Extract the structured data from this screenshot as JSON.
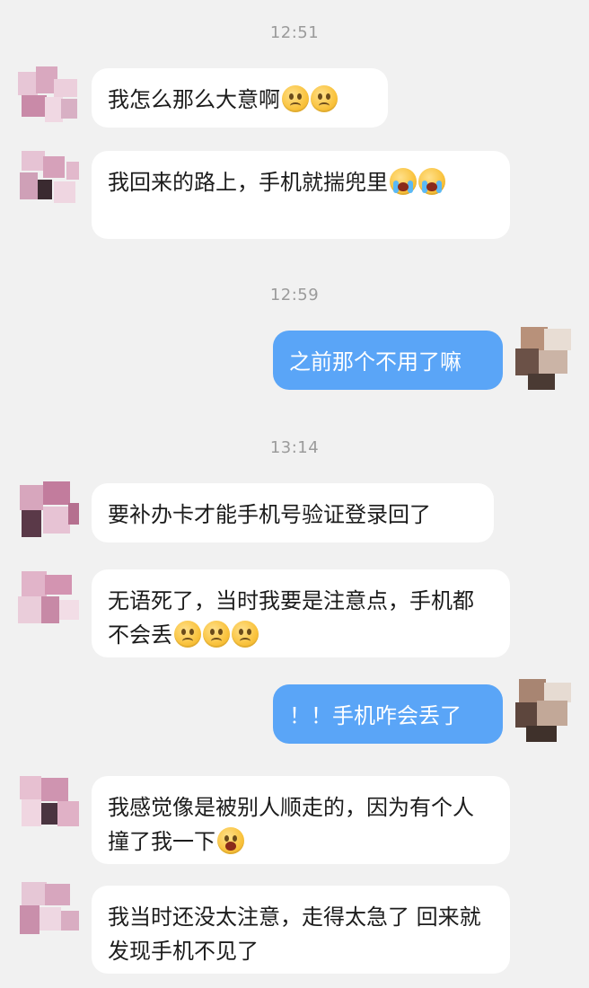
{
  "colors": {
    "background": "#f1f1f1",
    "incoming_bubble": "#ffffff",
    "outgoing_bubble": "#5aa5f7",
    "timestamp": "#9b9b9b"
  },
  "timestamps": [
    "12:51",
    "12:59",
    "13:14"
  ],
  "messages": [
    {
      "direction": "in",
      "text": "我怎么那么大意啊",
      "emojis": [
        "pleading-face-icon",
        "pleading-face-icon"
      ]
    },
    {
      "direction": "in",
      "text": "我回来的路上，手机就揣兜里",
      "emojis": [
        "loudly-crying-face-icon",
        "loudly-crying-face-icon"
      ]
    },
    {
      "direction": "out",
      "text": "之前那个不用了嘛",
      "emojis": []
    },
    {
      "direction": "in",
      "text": "要补办卡才能手机号验证登录回了",
      "emojis": []
    },
    {
      "direction": "in",
      "text": "无语死了，当时我要是注意点，手机都不会丢",
      "emojis": [
        "pleading-face-icon",
        "pleading-face-icon",
        "pleading-face-icon"
      ]
    },
    {
      "direction": "out",
      "text": "！！手机咋会丢了",
      "emojis": []
    },
    {
      "direction": "in",
      "text": "我感觉像是被别人顺走的，因为有个人撞了我一下",
      "emojis": [
        "tired-face-icon"
      ]
    },
    {
      "direction": "in",
      "text": "我当时还没太注意，走得太急了 回来就发现手机不见了",
      "emojis": []
    }
  ]
}
